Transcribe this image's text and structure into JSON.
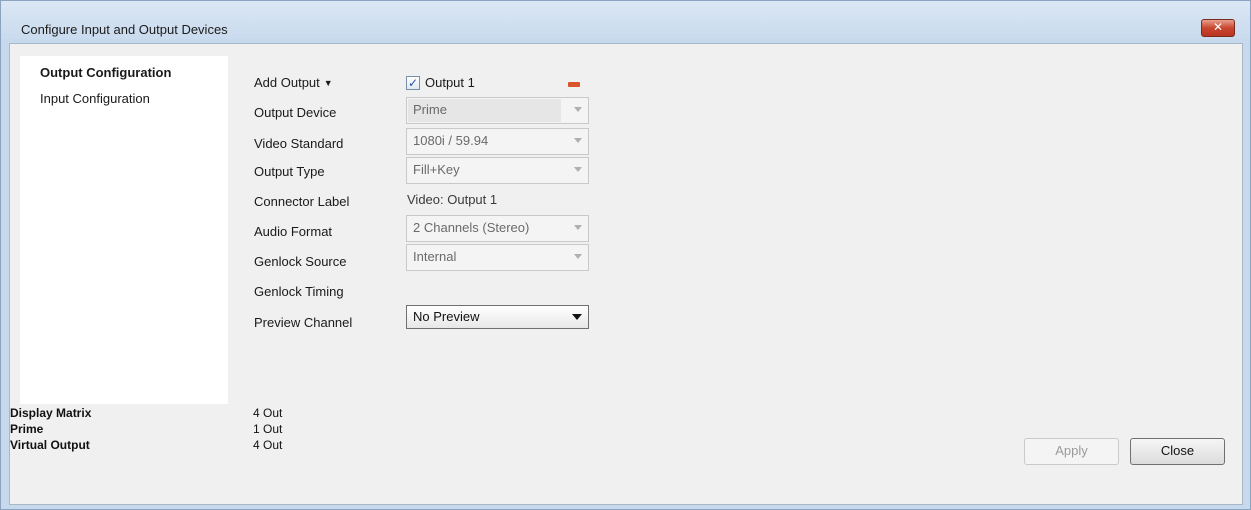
{
  "window": {
    "title": "Configure Input and Output Devices",
    "close_glyph": "✕"
  },
  "nav": {
    "items": [
      {
        "label": "Output Configuration",
        "active": true
      },
      {
        "label": "Input Configuration",
        "active": false
      }
    ]
  },
  "output": {
    "add_output_label": "Add Output",
    "add_output_caret": "▼",
    "checkbox_label": "Output 1",
    "checkbox_checked": true,
    "check_glyph": "✓",
    "remove_icon": "minus-icon",
    "remove_color": "#d9542a",
    "fields": {
      "output_device": {
        "label": "Output Device",
        "value": "Prime"
      },
      "video_standard": {
        "label": "Video Standard",
        "value": "1080i / 59.94"
      },
      "output_type": {
        "label": "Output Type",
        "value": "Fill+Key"
      },
      "connector_label": {
        "label": "Connector Label",
        "value": "Video: Output 1"
      },
      "audio_format": {
        "label": "Audio Format",
        "value": "2 Channels (Stereo)"
      },
      "genlock_source": {
        "label": "Genlock Source",
        "value": "Internal"
      },
      "genlock_timing": {
        "label": "Genlock Timing"
      },
      "preview_channel": {
        "label": "Preview Channel",
        "value": "No Preview"
      }
    }
  },
  "summary": [
    {
      "name": "Display Matrix",
      "value": "4 Out"
    },
    {
      "name": "Prime",
      "value": "1 Out"
    },
    {
      "name": "Virtual Output",
      "value": "4 Out"
    }
  ],
  "buttons": {
    "apply": "Apply",
    "close": "Close"
  }
}
